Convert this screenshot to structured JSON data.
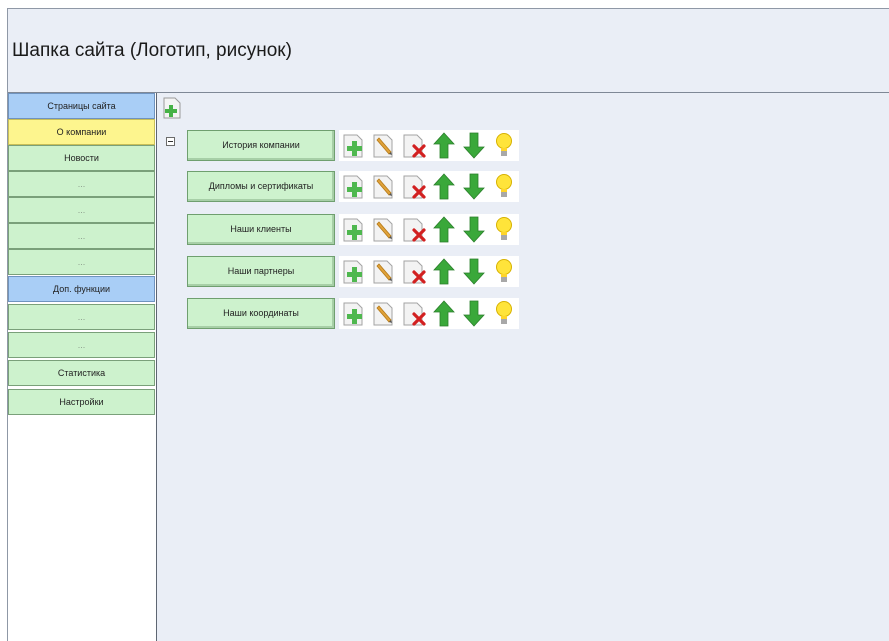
{
  "header": {
    "title": "Шапка сайта (Логотип, рисунок)"
  },
  "sidebar": {
    "items": [
      {
        "label": "Страницы сайта",
        "style": "blue"
      },
      {
        "label": "О компании",
        "style": "yellow"
      },
      {
        "label": "Новости",
        "style": "green"
      },
      {
        "label": "...",
        "style": "green"
      },
      {
        "label": "...",
        "style": "green"
      },
      {
        "label": "...",
        "style": "green"
      },
      {
        "label": "...",
        "style": "green"
      },
      {
        "label": "Доп. функции",
        "style": "blue"
      },
      {
        "label": "...",
        "style": "green"
      },
      {
        "label": "...",
        "style": "green"
      },
      {
        "label": "Статистика",
        "style": "green"
      },
      {
        "label": "Настройки",
        "style": "green"
      }
    ]
  },
  "content": {
    "pages": [
      {
        "label": "История компании"
      },
      {
        "label": "Дипломы и сертификаты"
      },
      {
        "label": "Наши клиенты"
      },
      {
        "label": "Наши партнеры"
      },
      {
        "label": "Наши координаты"
      }
    ],
    "row_actions": [
      "add-icon",
      "edit-icon",
      "delete-icon",
      "move-up-icon",
      "move-down-icon",
      "lightbulb-icon"
    ]
  },
  "colors": {
    "panel_bg": "#eaeef6",
    "nav_green": "#cdf2cd",
    "nav_blue": "#a9cef6",
    "nav_active_yellow": "#fdf58e"
  }
}
